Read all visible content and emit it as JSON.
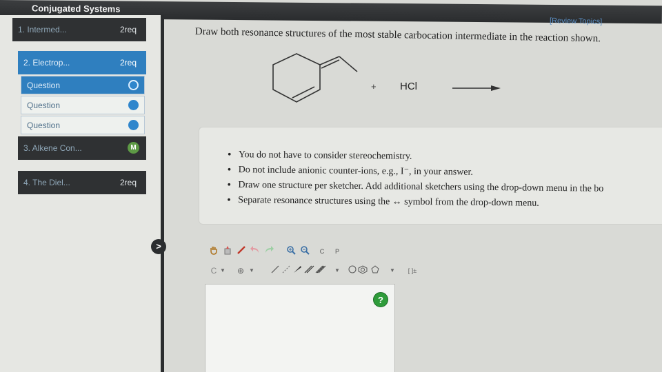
{
  "header": {
    "title": "Conjugated Systems",
    "review_link": "[Review Topics]"
  },
  "sidebar": {
    "sections": [
      {
        "label": "1. Intermed...",
        "req": "2req"
      },
      {
        "label": "2. Electrop...",
        "req": "2req"
      },
      {
        "label": "3. Alkene Con...",
        "badge": "M"
      },
      {
        "label": "4. The Diel...",
        "req": "2req"
      }
    ],
    "questions": [
      {
        "label": "Question"
      },
      {
        "label": "Question"
      },
      {
        "label": "Question"
      }
    ],
    "expand": ">"
  },
  "main": {
    "prompt": "Draw both resonance structures of the most stable carbocation intermediate in the reaction shown.",
    "reaction": {
      "plus": "+",
      "reagent": "HCl"
    },
    "notes": [
      "You do not have to consider stereochemistry.",
      "Do not include anionic counter-ions, e.g., I⁻, in your answer.",
      "Draw one structure per sketcher. Add additional sketchers using the drop-down menu in the bo",
      "Separate resonance structures using the ↔ symbol from the drop-down menu."
    ],
    "toolbar": {
      "row1": [
        "pan",
        "erase",
        "draw",
        "undo",
        "redo",
        "zoom-in",
        "zoom-out",
        "copy",
        "paste"
      ],
      "copy_label": "C",
      "paste_label": "P",
      "row2_text": {
        "charge_c": "C",
        "add": "⊕",
        "bracket": "[ ]±"
      }
    },
    "help": "?"
  }
}
